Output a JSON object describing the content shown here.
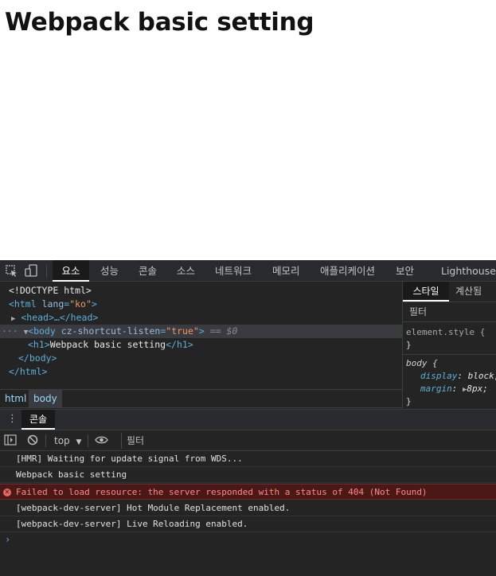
{
  "page": {
    "heading": "Webpack basic setting"
  },
  "devtools": {
    "tabs": [
      "요소",
      "성능",
      "콘솔",
      "소스",
      "네트워크",
      "메모리",
      "애플리케이션",
      "보안",
      "Lighthouse"
    ],
    "active_tab": "요소",
    "elements": {
      "doctype": "<!DOCTYPE html>",
      "html_open_tag": "<html",
      "html_lang_attr": "lang",
      "html_lang_val": "\"ko\"",
      "head_collapsed": "<head>…</head>",
      "body_open_tag": "<body",
      "body_attr": "cz-shortcut-listen",
      "body_attr_val": "\"true\"",
      "body_marker": "== $0",
      "h1_open": "<h1>",
      "h1_text": "Webpack basic setting",
      "h1_close": "</h1>",
      "body_close": "</body>",
      "html_close": "</html>",
      "dots": "···"
    },
    "breadcrumb": [
      "html",
      "body"
    ],
    "styles": {
      "tabs": [
        "스타일",
        "계산됨"
      ],
      "filter_placeholder": "필터",
      "element_style": "element.style {",
      "close_brace": "}",
      "body_selector": "body {",
      "props": [
        {
          "name": "display",
          "value": "block;"
        },
        {
          "name": "margin",
          "value": "8px;"
        }
      ]
    },
    "drawer": {
      "tab": "콘솔"
    },
    "console_toolbar": {
      "context": "top",
      "filter_placeholder": "필터"
    },
    "console_messages": [
      {
        "text": "[HMR] Waiting for update signal from WDS...",
        "level": "info"
      },
      {
        "text": "Webpack basic setting",
        "level": "info"
      },
      {
        "text": "Failed to load resource: the server responded with a status of 404 (Not Found)",
        "level": "error"
      },
      {
        "text": "[webpack-dev-server] Hot Module Replacement enabled.",
        "level": "info"
      },
      {
        "text": "[webpack-dev-server] Live Reloading enabled.",
        "level": "info"
      }
    ],
    "prompt": "›"
  },
  "colors": {
    "accent_tag": "#5db0d7",
    "error_bg": "#4b1818",
    "error_text": "#ff8a8a",
    "prompt": "#4fa3ff"
  }
}
